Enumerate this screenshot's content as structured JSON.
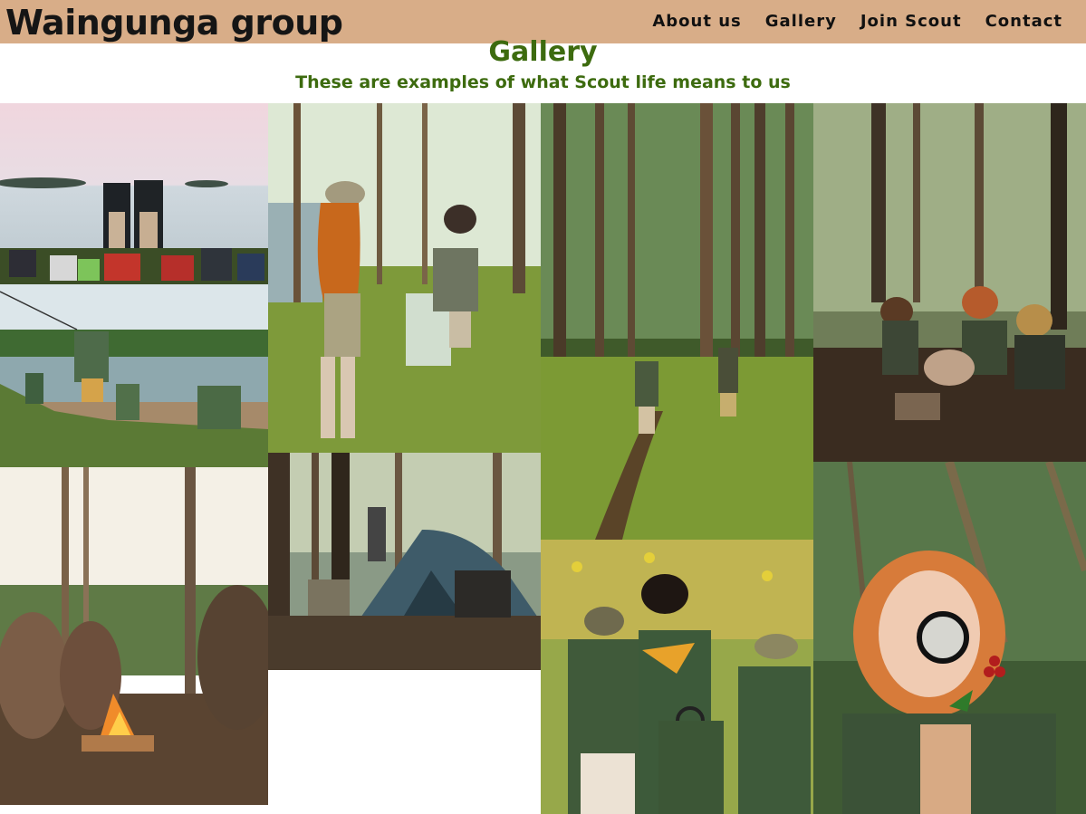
{
  "header": {
    "brand": "Waingunga group",
    "nav": [
      {
        "label": "About us"
      },
      {
        "label": "Gallery"
      },
      {
        "label": "Join Scout"
      },
      {
        "label": "Contact"
      }
    ]
  },
  "gallery": {
    "title": "Gallery",
    "subtitle": "These are examples of what Scout life means to us"
  },
  "colors": {
    "navbar": "#d8ad88",
    "heading": "#3d6b0f"
  }
}
